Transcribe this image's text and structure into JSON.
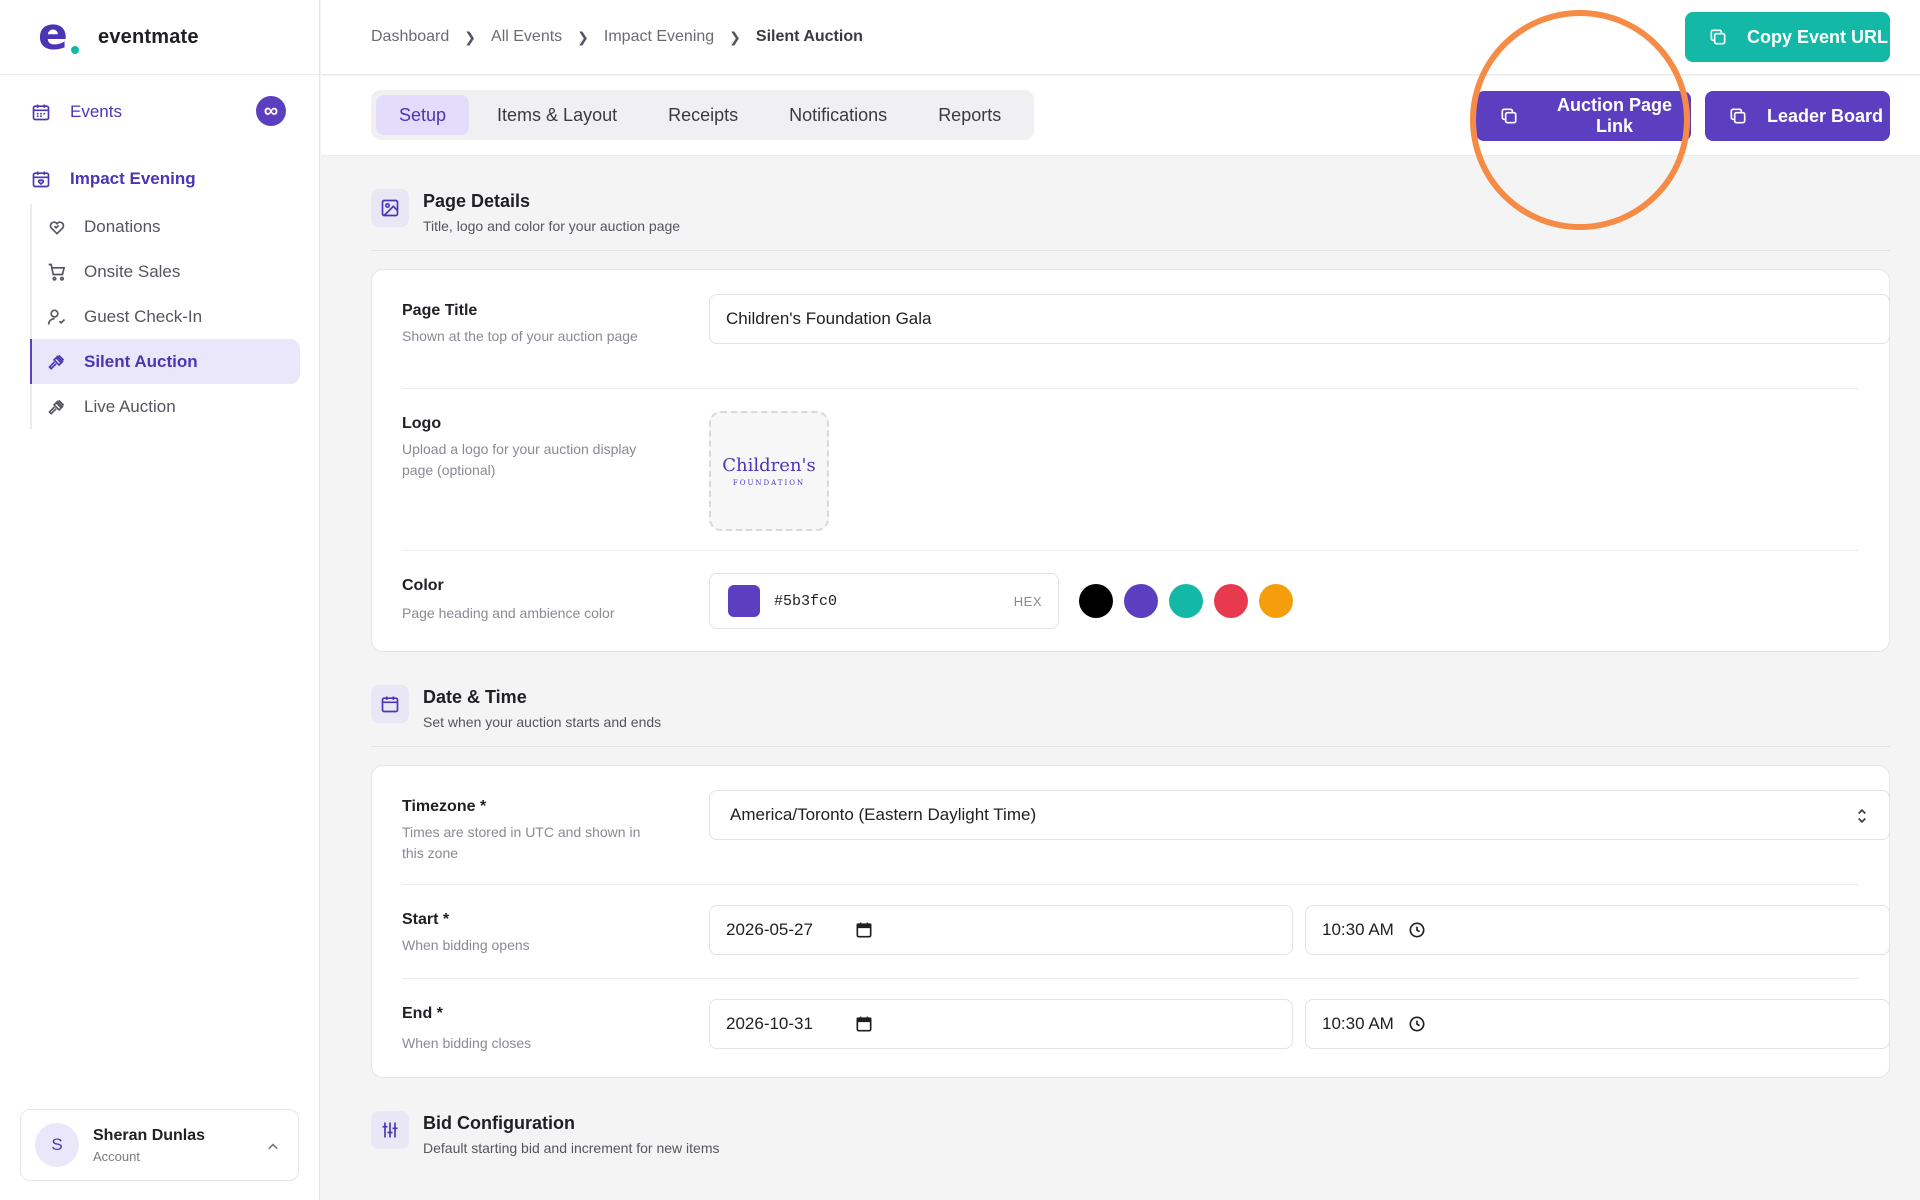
{
  "app": {
    "name": "eventmate",
    "logo_letter": "e"
  },
  "sidebar": {
    "events_label": "Events",
    "infinity_badge": "∞",
    "event_name": "Impact Evening",
    "items": [
      {
        "label": "Donations",
        "icon": "heart-handshake-icon"
      },
      {
        "label": "Onsite Sales",
        "icon": "cart-icon"
      },
      {
        "label": "Guest Check-In",
        "icon": "user-check-icon"
      },
      {
        "label": "Silent Auction",
        "icon": "gavel-icon",
        "active": true
      },
      {
        "label": "Live Auction",
        "icon": "gavel-icon"
      }
    ],
    "account": {
      "initial": "S",
      "name": "Sheran Dunlas",
      "role": "Account"
    }
  },
  "breadcrumb": [
    "Dashboard",
    "All Events",
    "Impact Evening",
    "Silent Auction"
  ],
  "header": {
    "copy_url_label": "Copy Event URL"
  },
  "tabs": [
    "Setup",
    "Items & Layout",
    "Receipts",
    "Notifications",
    "Reports"
  ],
  "actions": {
    "auction_link_label": "Auction Page Link",
    "leader_board_label": "Leader Board"
  },
  "page_details": {
    "title": "Page Details",
    "subtitle": "Title, logo and color for your auction page",
    "page_title": {
      "label": "Page Title",
      "desc": "Shown at the top of your auction page",
      "value": "Children's Foundation Gala"
    },
    "logo": {
      "label": "Logo",
      "desc": "Upload a logo for your auction display page (optional)",
      "text_main": "Children's",
      "text_sub": "FOUNDATION"
    },
    "color": {
      "label": "Color",
      "desc": "Page heading and ambience color",
      "value": "#5b3fc0",
      "format": "HEX",
      "swatches": [
        "#000000",
        "#5b3fc0",
        "#14b8a6",
        "#e83a4f",
        "#f59e0b"
      ]
    }
  },
  "date_time": {
    "title": "Date & Time",
    "subtitle": "Set when your auction starts and ends",
    "timezone": {
      "label": "Timezone *",
      "desc": "Times are stored in UTC and shown in this zone",
      "value": "America/Toronto (Eastern Daylight Time)"
    },
    "start": {
      "label": "Start *",
      "desc": "When bidding opens",
      "date": "2026-05-27",
      "time": "10:30 AM"
    },
    "end": {
      "label": "End *",
      "desc": "When bidding closes",
      "date": "2026-10-31",
      "time": "10:30 AM"
    }
  },
  "bid_config": {
    "title": "Bid Configuration",
    "subtitle": "Default starting bid and increment for new items"
  }
}
